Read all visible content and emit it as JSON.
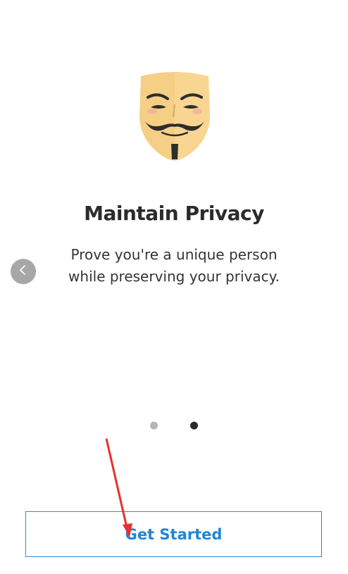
{
  "onboarding": {
    "illustration_icon": "guy-fawkes-mask-icon",
    "title": "Maintain Privacy",
    "description_lines": [
      "Prove you're a unique person",
      "while preserving your privacy."
    ],
    "prev_icon": "chevron-left-icon",
    "pagination": {
      "total": 2,
      "active_index": 1
    },
    "cta_label": "Get Started"
  },
  "colors": {
    "accent": "#1f85d6",
    "title": "#2b2b2b",
    "dot_active": "#2a2a2a",
    "dot_inactive": "#b5b5b5",
    "annotation_arrow": "#e8302e"
  }
}
